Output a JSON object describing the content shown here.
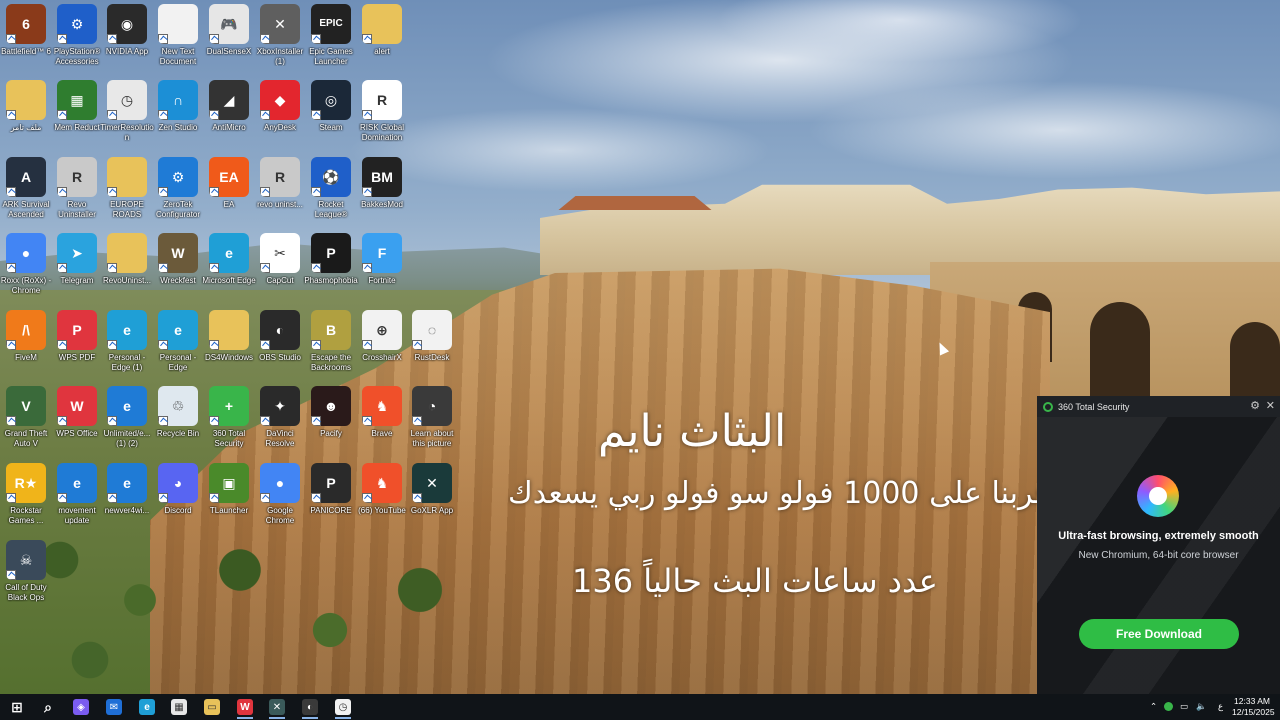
{
  "overlay": {
    "title": "البثاث نايم",
    "line2": "قربنا على 1000 فولو سو فولو ربي يسعدك",
    "line3": "عدد ساعات البث حالياً 136"
  },
  "desktop_icons": [
    {
      "label": "Battlefield™ 6",
      "icon": "battlefield-icon",
      "color": "#8a3a1a",
      "glyph": "6"
    },
    {
      "label": "PlayStation® Accessories",
      "icon": "playstation-icon",
      "color": "#1f5fc9",
      "glyph": "⚙"
    },
    {
      "label": "NVIDIA App",
      "icon": "nvidia-icon",
      "color": "#2a2a2a",
      "glyph": "◉"
    },
    {
      "label": "New Text Document",
      "icon": "text-document-icon",
      "color": "#f2f2f2",
      "glyph": ""
    },
    {
      "label": "DualSenseX",
      "icon": "controller-icon",
      "color": "#e6e6e6",
      "glyph": "🎮"
    },
    {
      "label": "XboxInstaller (1)",
      "icon": "xbox-icon",
      "color": "#5f5f5f",
      "glyph": "✕"
    },
    {
      "label": "Epic Games Launcher",
      "icon": "epic-games-icon",
      "color": "#222",
      "glyph": "EPIC"
    },
    {
      "label": "alert",
      "icon": "folder-icon",
      "color": "#e8c25a",
      "glyph": ""
    },
    {
      "label": "ملف تامر",
      "icon": "folder-icon",
      "color": "#e8c25a",
      "glyph": ""
    },
    {
      "label": "Mem Reduct",
      "icon": "mem-reduct-icon",
      "color": "#2f7d2f",
      "glyph": "▦"
    },
    {
      "label": "TimerResolution",
      "icon": "clock-icon",
      "color": "#e8e8e8",
      "glyph": "◷"
    },
    {
      "label": "Zen Studio",
      "icon": "zen-studio-icon",
      "color": "#1c8fd6",
      "glyph": "∩"
    },
    {
      "label": "AntiMicro",
      "icon": "antimicro-icon",
      "color": "#333",
      "glyph": "◢"
    },
    {
      "label": "AnyDesk",
      "icon": "anydesk-icon",
      "color": "#e3262e",
      "glyph": "◆"
    },
    {
      "label": "Steam",
      "icon": "steam-icon",
      "color": "#1b2838",
      "glyph": "◎"
    },
    {
      "label": "RISK Global Domination",
      "icon": "risk-icon",
      "color": "#fff",
      "glyph": "R"
    },
    {
      "label": "ARK Survival Ascended",
      "icon": "ark-icon",
      "color": "#253040",
      "glyph": "A"
    },
    {
      "label": "Revo Uninstaller",
      "icon": "revo-uninstaller-icon",
      "color": "#c9c9c9",
      "glyph": "R"
    },
    {
      "label": "EUROPE ROADS",
      "icon": "folder-icon",
      "color": "#e8c25a",
      "glyph": ""
    },
    {
      "label": "ZeroTek Configurator",
      "icon": "configurator-icon",
      "color": "#1f7bd6",
      "glyph": "⚙"
    },
    {
      "label": "EA",
      "icon": "ea-icon",
      "color": "#f05a1a",
      "glyph": "EA"
    },
    {
      "label": "revo uninst...",
      "icon": "revo-uninstaller-icon",
      "color": "#c9c9c9",
      "glyph": "R"
    },
    {
      "label": "Rocket League®",
      "icon": "rocket-league-icon",
      "color": "#1f5fc9",
      "glyph": "⚽"
    },
    {
      "label": "BakkesMod",
      "icon": "bakkesmod-icon",
      "color": "#222",
      "glyph": "BM"
    },
    {
      "label": "Roxx (RoXx) - Chrome",
      "icon": "chrome-icon",
      "color": "#4285f4",
      "glyph": "●"
    },
    {
      "label": "Telegram",
      "icon": "telegram-icon",
      "color": "#2aa3de",
      "glyph": "➤"
    },
    {
      "label": "RevoUninst...",
      "icon": "folder-icon",
      "color": "#e8c25a",
      "glyph": ""
    },
    {
      "label": "Wreckfest",
      "icon": "wreckfest-icon",
      "color": "#6b5a3a",
      "glyph": "W"
    },
    {
      "label": "Microsoft Edge",
      "icon": "edge-icon",
      "color": "#1f9fd6",
      "glyph": "e"
    },
    {
      "label": "CapCut",
      "icon": "capcut-icon",
      "color": "#fff",
      "glyph": "✂"
    },
    {
      "label": "Phasmophobia",
      "icon": "phasmophobia-icon",
      "color": "#1a1a1a",
      "glyph": "P"
    },
    {
      "label": "Fortnite",
      "icon": "fortnite-icon",
      "color": "#3aa0f0",
      "glyph": "F"
    },
    {
      "label": "FiveM",
      "icon": "fivem-icon",
      "color": "#f07a1a",
      "glyph": "/\\"
    },
    {
      "label": "WPS PDF",
      "icon": "wps-pdf-icon",
      "color": "#e0353e",
      "glyph": "P"
    },
    {
      "label": "Personal - Edge (1)",
      "icon": "edge-icon",
      "color": "#1f9fd6",
      "glyph": "e"
    },
    {
      "label": "Personal - Edge",
      "icon": "edge-icon",
      "color": "#1f9fd6",
      "glyph": "e"
    },
    {
      "label": "DS4Windows",
      "icon": "folder-icon",
      "color": "#e8c25a",
      "glyph": ""
    },
    {
      "label": "OBS Studio",
      "icon": "obs-icon",
      "color": "#2a2a2a",
      "glyph": "◐"
    },
    {
      "label": "Escape the Backrooms",
      "icon": "backrooms-icon",
      "color": "#b0a040",
      "glyph": "B"
    },
    {
      "label": "CrosshairX",
      "icon": "crosshair-icon",
      "color": "#f2f2f2",
      "glyph": "⊕"
    },
    {
      "label": "RustDesk",
      "icon": "rustdesk-icon",
      "color": "#f2f2f2",
      "glyph": "◌"
    },
    {
      "label": "Grand Theft Auto V",
      "icon": "gta-icon",
      "color": "#3a6a3a",
      "glyph": "V"
    },
    {
      "label": "WPS Office",
      "icon": "wps-office-icon",
      "color": "#e0353e",
      "glyph": "W"
    },
    {
      "label": "Unlimited/e... (1) (2)",
      "icon": "ie-icon",
      "color": "#1f7bd6",
      "glyph": "e"
    },
    {
      "label": "Recycle Bin",
      "icon": "recycle-bin-icon",
      "color": "#dfe8ef",
      "glyph": "♲"
    },
    {
      "label": "360 Total Security",
      "icon": "360-security-icon",
      "color": "#39b54a",
      "glyph": "+"
    },
    {
      "label": "DaVinci Resolve",
      "icon": "davinci-icon",
      "color": "#2a2a2a",
      "glyph": "✦"
    },
    {
      "label": "Pacify",
      "icon": "pacify-icon",
      "color": "#2a1a1a",
      "glyph": "☻"
    },
    {
      "label": "Brave",
      "icon": "brave-icon",
      "color": "#f0502a",
      "glyph": "♞"
    },
    {
      "label": "Learn about this picture",
      "icon": "learn-picture-icon",
      "color": "#3a3a3a",
      "glyph": "◔"
    },
    {
      "label": "Rockstar Games ...",
      "icon": "rockstar-icon",
      "color": "#f0b41a",
      "glyph": "R★"
    },
    {
      "label": "movement update",
      "icon": "ie-icon",
      "color": "#1f7bd6",
      "glyph": "e"
    },
    {
      "label": "newver4wi...",
      "icon": "ie-icon",
      "color": "#1f7bd6",
      "glyph": "e"
    },
    {
      "label": "Discord",
      "icon": "discord-icon",
      "color": "#5865f2",
      "glyph": "◕"
    },
    {
      "label": "TLauncher",
      "icon": "tlauncher-icon",
      "color": "#4a8a2a",
      "glyph": "▣"
    },
    {
      "label": "Google Chrome",
      "icon": "chrome-icon",
      "color": "#4285f4",
      "glyph": "●"
    },
    {
      "label": "PANICORE",
      "icon": "panicore-icon",
      "color": "#2a2a2a",
      "glyph": "P"
    },
    {
      "label": "(66) YouTube",
      "icon": "brave-icon",
      "color": "#f0502a",
      "glyph": "♞"
    },
    {
      "label": "GoXLR App",
      "icon": "goxlr-icon",
      "color": "#1a3a3a",
      "glyph": "✕"
    },
    {
      "label": "Call of Duty Black Ops",
      "icon": "cod-icon",
      "color": "#3a4a5a",
      "glyph": "☠"
    }
  ],
  "popup": {
    "title": "360 Total Security",
    "headline": "Ultra-fast browsing, extremely smooth",
    "subline": "New Chromium, 64-bit core browser",
    "button": "Free Download",
    "accent": "#2fbd45"
  },
  "taskbar": {
    "items": [
      {
        "icon": "windows-start-icon",
        "color": "#ffffff",
        "glyph": "⊞"
      },
      {
        "icon": "search-icon",
        "color": "#ffffff",
        "glyph": "⌕"
      },
      {
        "icon": "copilot-icon",
        "color": "#7a5cf0",
        "glyph": "◈"
      },
      {
        "icon": "outlook-icon",
        "color": "#1f6fd6",
        "glyph": "✉"
      },
      {
        "icon": "edge-icon",
        "color": "#1f9fd6",
        "glyph": "e"
      },
      {
        "icon": "store-icon",
        "color": "#e8e8e8",
        "glyph": "▦"
      },
      {
        "icon": "file-explorer-icon",
        "color": "#e8c25a",
        "glyph": "▭"
      },
      {
        "icon": "wps-office-icon",
        "color": "#e0353e",
        "glyph": "W"
      },
      {
        "icon": "goxlr-icon",
        "color": "#3a5a5a",
        "glyph": "✕"
      },
      {
        "icon": "obs-icon",
        "color": "#3a3a3a",
        "glyph": "◐"
      },
      {
        "icon": "timer-icon",
        "color": "#f2f2f2",
        "glyph": "◷"
      }
    ],
    "tray": {
      "lang": "ع",
      "time": "12:33 AM",
      "date": "12/15/2025"
    }
  }
}
